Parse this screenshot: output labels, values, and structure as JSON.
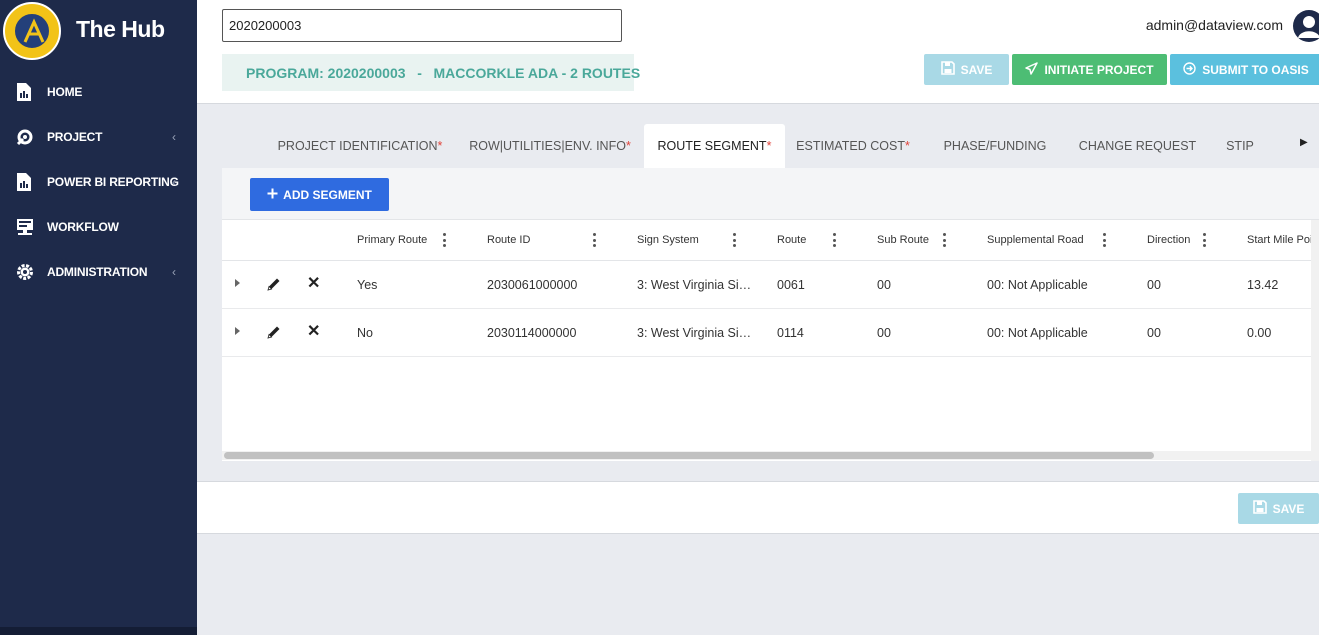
{
  "app": {
    "title": "The Hub"
  },
  "sidebar": {
    "items": [
      {
        "label": "HOME",
        "icon": "report-icon",
        "has_chevron": false
      },
      {
        "label": "PROJECT",
        "icon": "project-icon",
        "has_chevron": true
      },
      {
        "label": "POWER BI REPORTING",
        "icon": "report-icon",
        "has_chevron": true
      },
      {
        "label": "WORKFLOW",
        "icon": "workflow-icon",
        "has_chevron": false
      },
      {
        "label": "ADMINISTRATION",
        "icon": "gear-icon",
        "has_chevron": true
      }
    ],
    "chevron": "‹"
  },
  "header": {
    "search_value": "2020200003",
    "user_email": "admin@dataview.com",
    "program_banner": "PROGRAM: 2020200003   -   MACCORKLE ADA - 2 ROUTES",
    "save_label": "SAVE",
    "initiate_label": "INITIATE PROJECT",
    "submit_label": "SUBMIT TO OASIS"
  },
  "tabs": [
    {
      "label": "PROJECT IDENTIFICATION",
      "required": true
    },
    {
      "label": "ROW|UTILITIES|ENV. INFO",
      "required": true
    },
    {
      "label": "ROUTE SEGMENT",
      "required": true,
      "active": true
    },
    {
      "label": "ESTIMATED COST",
      "required": true
    },
    {
      "label": "PHASE/FUNDING",
      "required": false
    },
    {
      "label": "CHANGE REQUEST",
      "required": false
    },
    {
      "label": "STIP",
      "required": false
    }
  ],
  "required_marker": "*",
  "tab_scroll_arrow": "▶",
  "grid": {
    "add_label": "ADD SEGMENT",
    "columns": [
      "Primary Route",
      "Route ID",
      "Sign System",
      "Route",
      "Sub Route",
      "Supplemental Road",
      "Direction",
      "Start Mile Poi"
    ],
    "rows": [
      [
        "Yes",
        "2030061000000",
        "3: West Virginia Si…",
        "0061",
        "00",
        "00: Not Applicable",
        "00",
        "13.42"
      ],
      [
        "No",
        "2030114000000",
        "3: West Virginia Si…",
        "0114",
        "00",
        "00: Not Applicable",
        "00",
        "0.00"
      ]
    ],
    "delete_glyph": "✕"
  },
  "footer": {
    "save_label": "SAVE"
  },
  "colors": {
    "sidebar_bg": "#1e2a4a",
    "teal_text": "#4aa89a",
    "save_disabled": "#a9d9e6",
    "initiate": "#4dbd74",
    "submit": "#5bc0de",
    "add_segment": "#2f6be0",
    "required": "#e0433a"
  }
}
